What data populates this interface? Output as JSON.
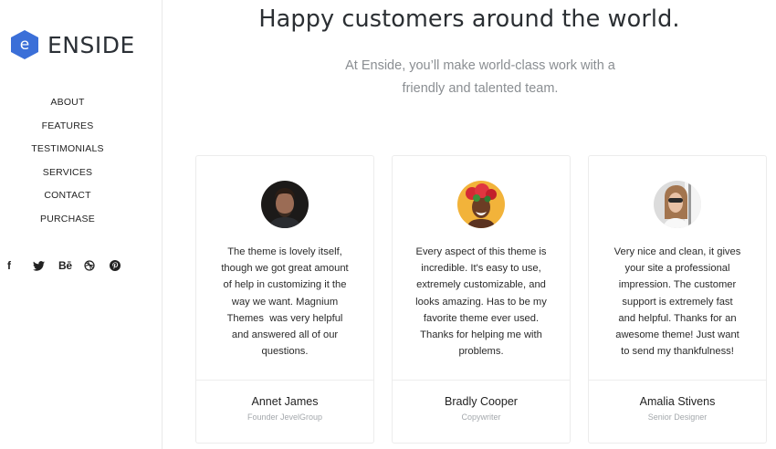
{
  "brand": {
    "logo_letter": "e",
    "name": "ENSIDE",
    "accent": "#3b6fd8"
  },
  "nav": {
    "items": [
      {
        "label": "ABOUT"
      },
      {
        "label": "FEATURES"
      },
      {
        "label": "TESTIMONIALS"
      },
      {
        "label": "SERVICES"
      },
      {
        "label": "CONTACT"
      },
      {
        "label": "PURCHASE"
      }
    ]
  },
  "social": {
    "icons": [
      "facebook-icon",
      "twitter-icon",
      "behance-icon",
      "dribbble-icon",
      "pinterest-icon"
    ],
    "facebook": "f",
    "behance": "Bē"
  },
  "header": {
    "title": "Happy customers around the world.",
    "subtitle_line1": "At Enside, you’ll make world-class work with a",
    "subtitle_line2": "friendly and talented team."
  },
  "testimonials": [
    {
      "lines": [
        "The theme is lovely itself,",
        "though we got great amount",
        "of help in customizing it the",
        "way we want. Magnium",
        "Themes  was very helpful",
        "and answered all of our",
        "questions."
      ],
      "name": "Annet James",
      "role": "Founder JevelGroup"
    },
    {
      "lines": [
        "Every aspect of this theme is",
        "incredible. It's easy to use,",
        "extremely customizable, and",
        "looks amazing. Has to be my",
        "favorite theme ever used.",
        "Thanks for helping me with",
        "problems."
      ],
      "name": "Bradly Cooper",
      "role": "Copywriter"
    },
    {
      "lines": [
        "Very nice and clean, it gives",
        "your site a professional",
        "impression. The customer",
        "support is extremely fast",
        "and helpful. Thanks for an",
        "awesome theme! Just want",
        "to send my thankfulness!"
      ],
      "name": "Amalia Stivens",
      "role": "Senior Designer"
    }
  ]
}
